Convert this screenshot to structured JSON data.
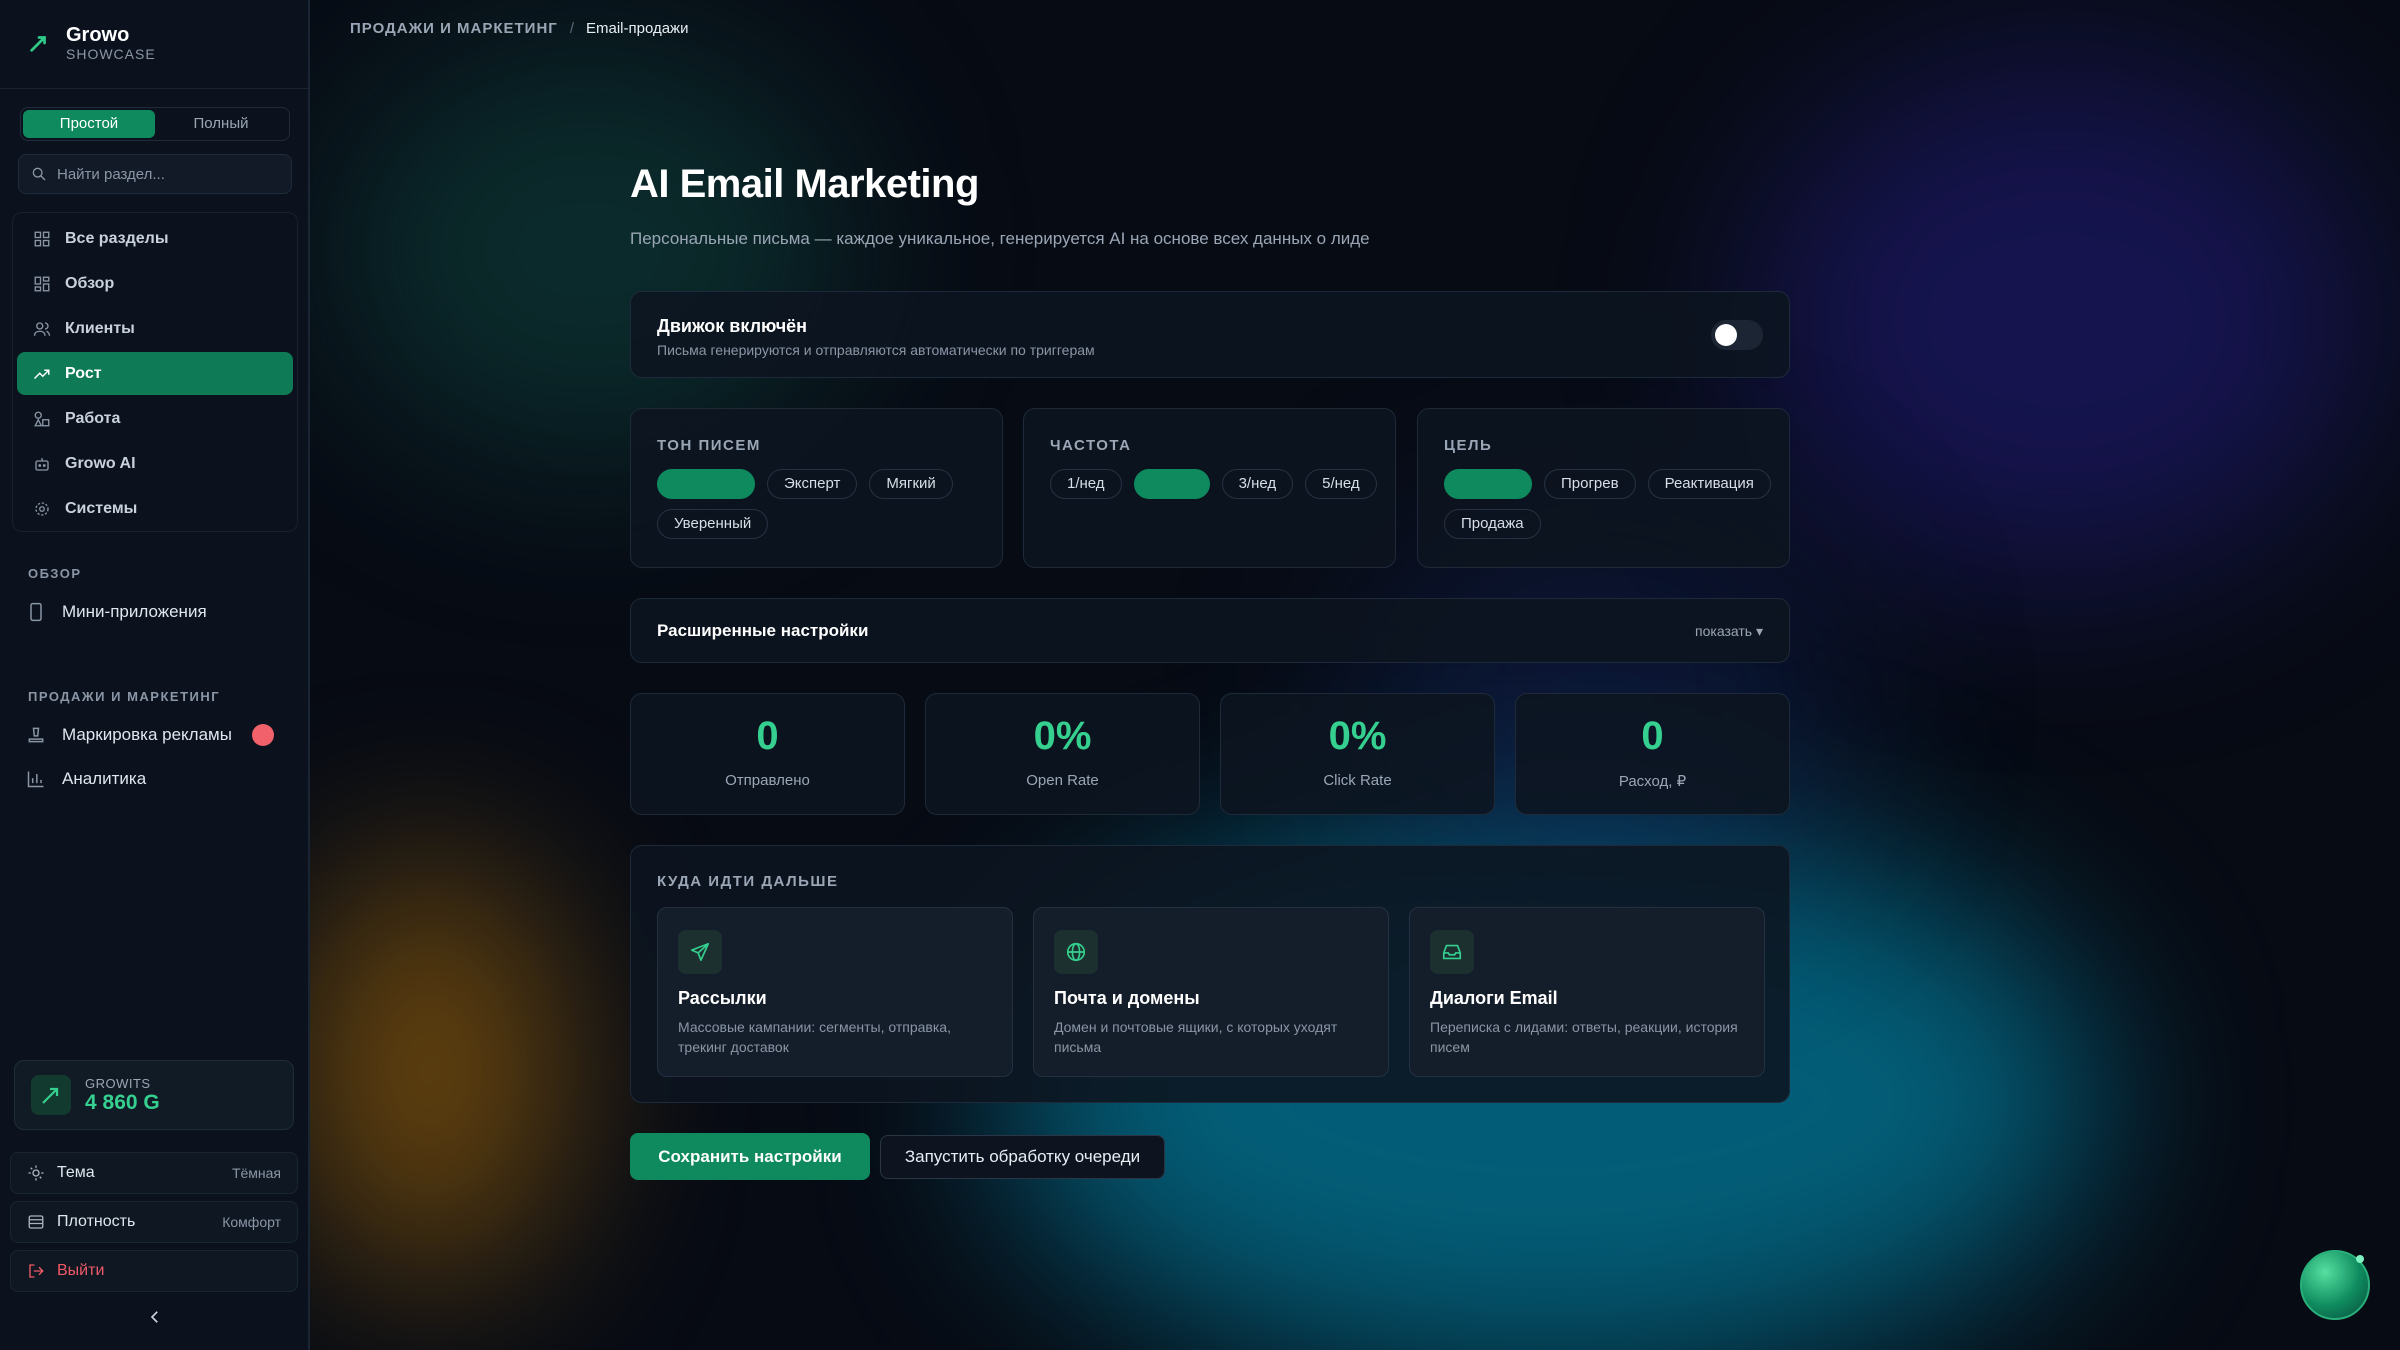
{
  "brand": {
    "name": "Growo",
    "sub": "SHOWCASE"
  },
  "mode": {
    "simple": "Простой",
    "full": "Полный"
  },
  "search": {
    "placeholder": "Найти раздел..."
  },
  "nav": [
    {
      "label": "Все разделы"
    },
    {
      "label": "Обзор"
    },
    {
      "label": "Клиенты"
    },
    {
      "label": "Рост"
    },
    {
      "label": "Работа"
    },
    {
      "label": "Growo AI"
    },
    {
      "label": "Системы"
    }
  ],
  "sections": {
    "overview": {
      "title": "ОБЗОР",
      "mini_apps": "Мини-приложения"
    },
    "sales": {
      "title": "ПРОДАЖИ И МАРКЕТИНГ",
      "ads": "Маркировка рекламы",
      "analytics": "Аналитика"
    }
  },
  "growits": {
    "label": "GROWITS",
    "value": "4 860 G"
  },
  "options": {
    "theme": {
      "label": "Тема",
      "value": "Тёмная"
    },
    "density": {
      "label": "Плотность",
      "value": "Комфорт"
    },
    "logout": "Выйти"
  },
  "breadcrumb": {
    "section": "ПРОДАЖИ И МАРКЕТИНГ",
    "sep": "/",
    "page": "Email-продажи"
  },
  "page": {
    "title": "AI Email Marketing",
    "subtitle": "Персональные письма — каждое уникальное, генерируется AI на основе всех данных о лиде"
  },
  "engine": {
    "title": "Движок включён",
    "desc": "Письма генерируются и отправляются автоматически по триггерам",
    "enabled": false
  },
  "tone": {
    "title": "ТОН ПИСЕМ",
    "chips": [
      "",
      "Эксперт",
      "Мягкий",
      "Уверенный"
    ]
  },
  "frequency": {
    "title": "ЧАСТОТА",
    "chips": [
      "1/нед",
      "",
      "3/нед",
      "5/нед"
    ]
  },
  "goal": {
    "title": "ЦЕЛЬ",
    "chips": [
      "",
      "Прогрев",
      "Реактивация",
      "Продажа"
    ]
  },
  "advanced": {
    "title": "Расширенные настройки",
    "toggle": "показать ▾"
  },
  "stats": [
    {
      "value": "0",
      "label": "Отправлено"
    },
    {
      "value": "0%",
      "label": "Open Rate"
    },
    {
      "value": "0%",
      "label": "Click Rate"
    },
    {
      "value": "0",
      "label": "Расход, ₽"
    }
  ],
  "next": {
    "title": "КУДА ИДТИ ДАЛЬШЕ",
    "cards": [
      {
        "title": "Рассылки",
        "desc": "Массовые кампании: сегменты, отправка, трекинг доставок"
      },
      {
        "title": "Почта и домены",
        "desc": "Домен и почтовые ящики, с которых уходят письма"
      },
      {
        "title": "Диалоги Email",
        "desc": "Переписка с лидами: ответы, реакции, история писем"
      }
    ]
  },
  "actions": {
    "save": "Сохранить настройки",
    "run": "Запустить обработку очереди"
  },
  "colors": {
    "accent": "#0e8a5e",
    "accent_text": "#35d08f",
    "danger": "#f0616b"
  }
}
